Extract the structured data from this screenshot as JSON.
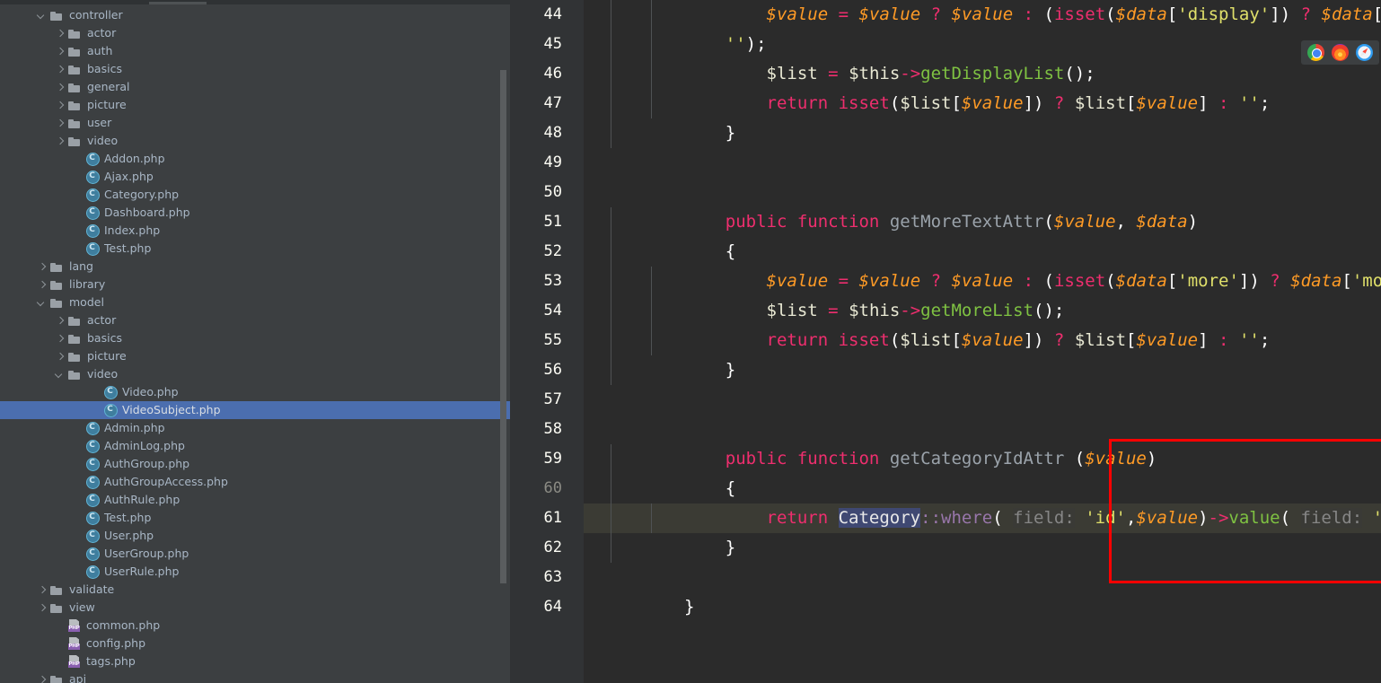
{
  "sidebar": {
    "scrollbar": "vertical-scrollbar",
    "tree": [
      {
        "label": "controller",
        "indent": 2,
        "state": "down",
        "icon": "folder"
      },
      {
        "label": "actor",
        "indent": 3,
        "state": "right",
        "icon": "folder"
      },
      {
        "label": "auth",
        "indent": 3,
        "state": "right",
        "icon": "folder"
      },
      {
        "label": "basics",
        "indent": 3,
        "state": "right",
        "icon": "folder"
      },
      {
        "label": "general",
        "indent": 3,
        "state": "right",
        "icon": "folder"
      },
      {
        "label": "picture",
        "indent": 3,
        "state": "right",
        "icon": "folder"
      },
      {
        "label": "user",
        "indent": 3,
        "state": "right",
        "icon": "folder"
      },
      {
        "label": "video",
        "indent": 3,
        "state": "right",
        "icon": "folder"
      },
      {
        "label": "Addon.php",
        "indent": 4,
        "state": "none",
        "icon": "phpclass"
      },
      {
        "label": "Ajax.php",
        "indent": 4,
        "state": "none",
        "icon": "phpclass"
      },
      {
        "label": "Category.php",
        "indent": 4,
        "state": "none",
        "icon": "phpclass"
      },
      {
        "label": "Dashboard.php",
        "indent": 4,
        "state": "none",
        "icon": "phpclass"
      },
      {
        "label": "Index.php",
        "indent": 4,
        "state": "none",
        "icon": "phpclass"
      },
      {
        "label": "Test.php",
        "indent": 4,
        "state": "none",
        "icon": "phpclass"
      },
      {
        "label": "lang",
        "indent": 2,
        "state": "right",
        "icon": "folder"
      },
      {
        "label": "library",
        "indent": 2,
        "state": "right",
        "icon": "folder"
      },
      {
        "label": "model",
        "indent": 2,
        "state": "down",
        "icon": "folder"
      },
      {
        "label": "actor",
        "indent": 3,
        "state": "right",
        "icon": "folder"
      },
      {
        "label": "basics",
        "indent": 3,
        "state": "right",
        "icon": "folder"
      },
      {
        "label": "picture",
        "indent": 3,
        "state": "right",
        "icon": "folder"
      },
      {
        "label": "video",
        "indent": 3,
        "state": "down",
        "icon": "folder"
      },
      {
        "label": "Video.php",
        "indent": 5,
        "state": "none",
        "icon": "phpclass"
      },
      {
        "label": "VideoSubject.php",
        "indent": 5,
        "state": "none",
        "icon": "phpclass",
        "selected": true
      },
      {
        "label": "Admin.php",
        "indent": 4,
        "state": "none",
        "icon": "phpclass"
      },
      {
        "label": "AdminLog.php",
        "indent": 4,
        "state": "none",
        "icon": "phpclass"
      },
      {
        "label": "AuthGroup.php",
        "indent": 4,
        "state": "none",
        "icon": "phpclass"
      },
      {
        "label": "AuthGroupAccess.php",
        "indent": 4,
        "state": "none",
        "icon": "phpclass"
      },
      {
        "label": "AuthRule.php",
        "indent": 4,
        "state": "none",
        "icon": "phpclass"
      },
      {
        "label": "Test.php",
        "indent": 4,
        "state": "none",
        "icon": "phpclass"
      },
      {
        "label": "User.php",
        "indent": 4,
        "state": "none",
        "icon": "phpclass"
      },
      {
        "label": "UserGroup.php",
        "indent": 4,
        "state": "none",
        "icon": "phpclass"
      },
      {
        "label": "UserRule.php",
        "indent": 4,
        "state": "none",
        "icon": "phpclass"
      },
      {
        "label": "validate",
        "indent": 2,
        "state": "right",
        "icon": "folder"
      },
      {
        "label": "view",
        "indent": 2,
        "state": "right",
        "icon": "folder"
      },
      {
        "label": "common.php",
        "indent": 3,
        "state": "none",
        "icon": "phpfile"
      },
      {
        "label": "config.php",
        "indent": 3,
        "state": "none",
        "icon": "phpfile"
      },
      {
        "label": "tags.php",
        "indent": 3,
        "state": "none",
        "icon": "phpfile"
      },
      {
        "label": "api",
        "indent": 2,
        "state": "right",
        "icon": "folder"
      }
    ]
  },
  "editor": {
    "first_line": 44,
    "last_line": 64,
    "current_line": 60,
    "line_numbers": [
      44,
      45,
      46,
      47,
      48,
      49,
      50,
      51,
      52,
      53,
      54,
      55,
      56,
      57,
      58,
      59,
      60,
      61,
      62,
      63,
      64
    ],
    "lines": [
      {
        "n": 44,
        "text": "        $value = $value ? $value : (isset($data['display']) ? $data['display'] : '');"
      },
      {
        "n": 45,
        "text": "        $list = $this->getDisplayList();"
      },
      {
        "n": 46,
        "text": "        return isset($list[$value]) ? $list[$value] : '';"
      },
      {
        "n": 47,
        "text": "    }"
      },
      {
        "n": 48,
        "text": ""
      },
      {
        "n": 49,
        "text": ""
      },
      {
        "n": 50,
        "text": "    public function getMoreTextAttr($value, $data)"
      },
      {
        "n": 51,
        "text": "    {"
      },
      {
        "n": 52,
        "text": "        $value = $value ? $value : (isset($data['more']) ? $data['more'] : '');"
      },
      {
        "n": 53,
        "text": "        $list = $this->getMoreList();"
      },
      {
        "n": 54,
        "text": "        return isset($list[$value]) ? $list[$value] : '';"
      },
      {
        "n": 55,
        "text": "    }"
      },
      {
        "n": 56,
        "text": ""
      },
      {
        "n": 57,
        "text": ""
      },
      {
        "n": 58,
        "text": "    public function getCategoryIdAttr ($value)"
      },
      {
        "n": 59,
        "text": "    {"
      },
      {
        "n": 60,
        "text": "        return Category::where( field: 'id',$value)->value( field: 'name');"
      },
      {
        "n": 61,
        "text": "    }"
      },
      {
        "n": 62,
        "text": ""
      },
      {
        "n": 63,
        "text": "}"
      },
      {
        "n": 64,
        "text": ""
      }
    ],
    "wrapped_continuation": "'');",
    "selection_token": "Category",
    "param_hints": [
      "field:",
      "field:"
    ],
    "fold_markers": [
      47,
      50,
      55,
      58,
      61,
      63
    ],
    "annotation": {
      "type": "red-rectangle",
      "covers_lines": "58-62"
    }
  },
  "browser_bar": {
    "icons": [
      "chrome-icon",
      "firefox-icon",
      "safari-icon"
    ]
  },
  "colors": {
    "sidebar_bg": "#3c3f41",
    "editor_bg": "#2b2b2b",
    "gutter_bg": "#313335",
    "selection_blue": "#4b6eaf",
    "current_line": "#3b3b34",
    "annotation_red": "#ff0000",
    "keyword_pink": "#ee2e6e",
    "variable_orange": "#ff9b26",
    "string_yellow": "#e0e06a",
    "method_green": "#7fc242",
    "static_purple": "#9876aa",
    "hint_gray": "#868686"
  }
}
